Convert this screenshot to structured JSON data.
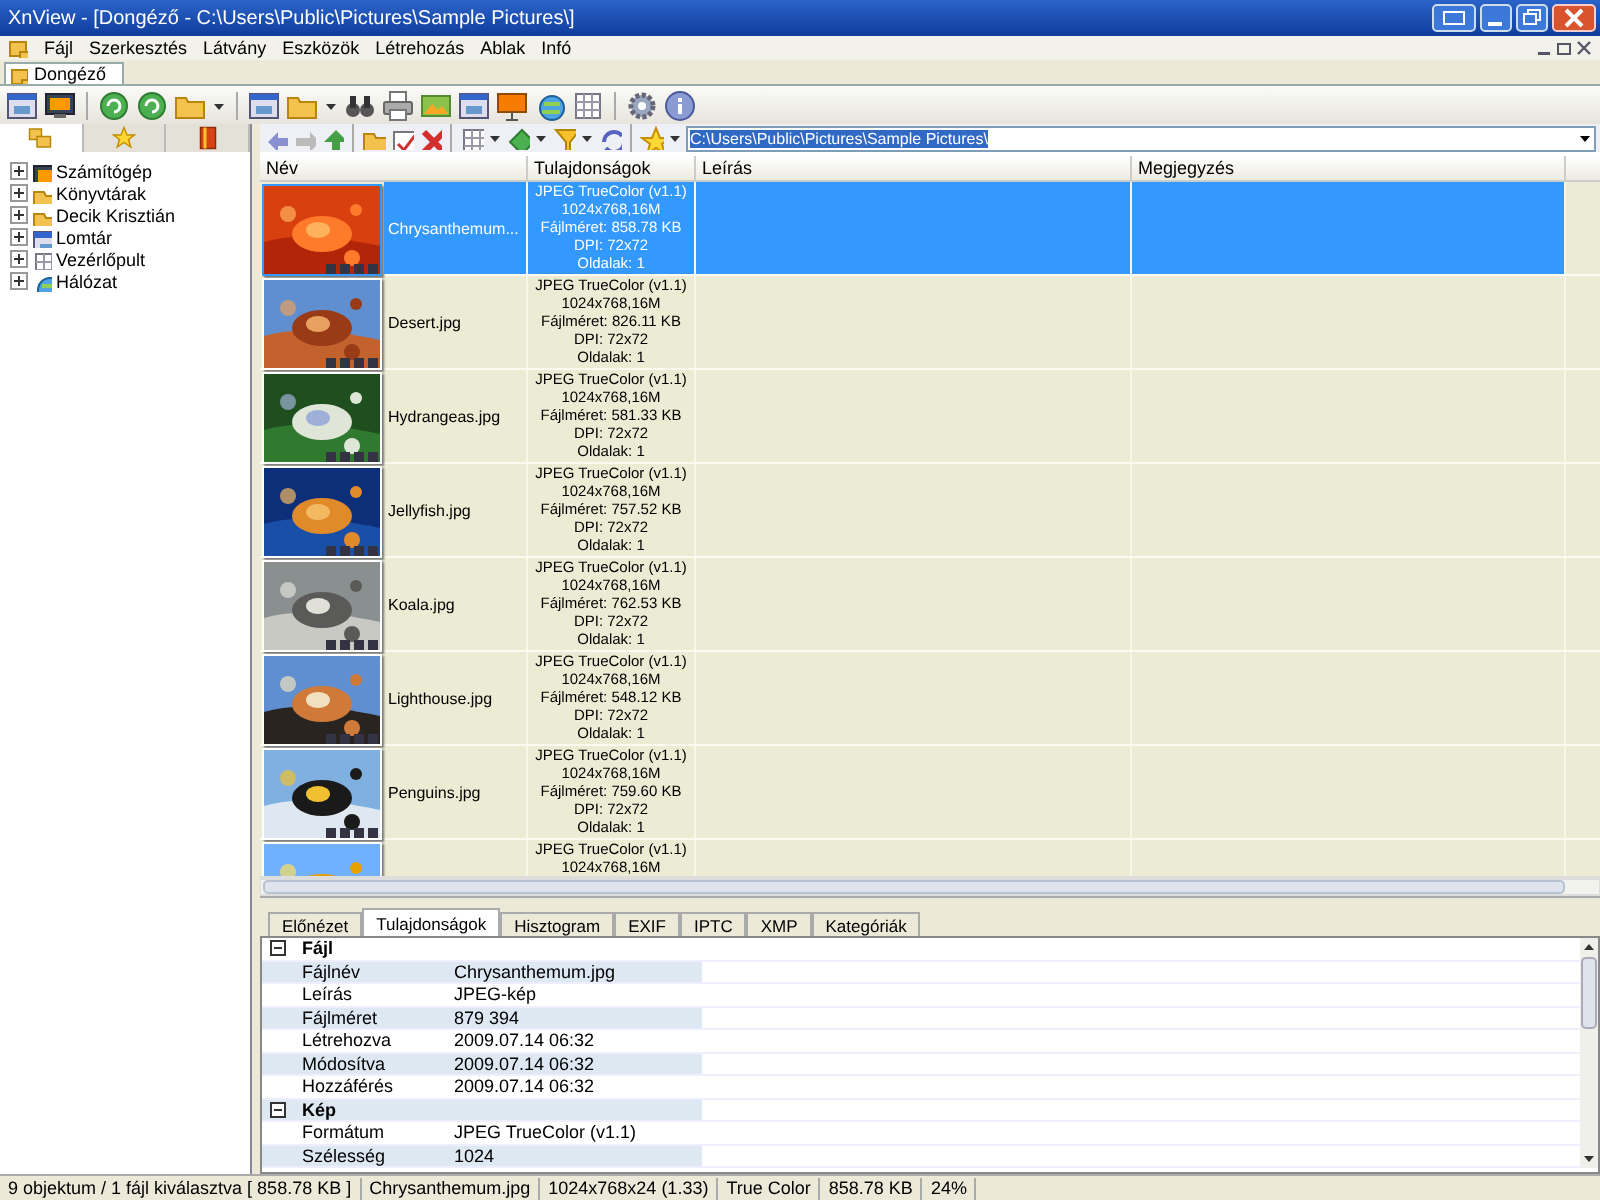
{
  "window": {
    "title": "XnView - [Dongéző - C:\\Users\\Public\\Pictures\\Sample Pictures\\]"
  },
  "menu": [
    "Fájl",
    "Szerkesztés",
    "Látvány",
    "Eszközök",
    "Létrehozás",
    "Ablak",
    "Infó"
  ],
  "document_tabs": [
    {
      "label": "Dongéző",
      "selected": true
    }
  ],
  "left_tabs": [
    {
      "selected": true
    },
    {
      "selected": false
    },
    {
      "selected": false
    }
  ],
  "folder_path": "C:\\Users\\Public\\Pictures\\Sample Pictures\\",
  "tree": [
    "Számítógép",
    "Könyvtárak",
    "Decik Krisztián",
    "Lomtár",
    "Vezérlőpult",
    "Hálózat"
  ],
  "file_list": {
    "columns": [
      "Név",
      "Tulajdonságok",
      "Leírás",
      "Megjegyzés"
    ],
    "rows": [
      {
        "name": "Chrysanthemum...",
        "selected": true,
        "properties": [
          "JPEG TrueColor (v1.1)",
          "1024x768,16M",
          "Fájlméret: 858.78 KB",
          "DPI: 72x72",
          "Oldalak: 1"
        ]
      },
      {
        "name": "Desert.jpg",
        "selected": false,
        "properties": [
          "JPEG TrueColor (v1.1)",
          "1024x768,16M",
          "Fájlméret: 826.11 KB",
          "DPI: 72x72",
          "Oldalak: 1"
        ]
      },
      {
        "name": "Hydrangeas.jpg",
        "selected": false,
        "properties": [
          "JPEG TrueColor (v1.1)",
          "1024x768,16M",
          "Fájlméret: 581.33 KB",
          "DPI: 72x72",
          "Oldalak: 1"
        ]
      },
      {
        "name": "Jellyfish.jpg",
        "selected": false,
        "properties": [
          "JPEG TrueColor (v1.1)",
          "1024x768,16M",
          "Fájlméret: 757.52 KB",
          "DPI: 72x72",
          "Oldalak: 1"
        ]
      },
      {
        "name": "Koala.jpg",
        "selected": false,
        "properties": [
          "JPEG TrueColor (v1.1)",
          "1024x768,16M",
          "Fájlméret: 762.53 KB",
          "DPI: 72x72",
          "Oldalak: 1"
        ]
      },
      {
        "name": "Lighthouse.jpg",
        "selected": false,
        "properties": [
          "JPEG TrueColor (v1.1)",
          "1024x768,16M",
          "Fájlméret: 548.12 KB",
          "DPI: 72x72",
          "Oldalak: 1"
        ]
      },
      {
        "name": "Penguins.jpg",
        "selected": false,
        "properties": [
          "JPEG TrueColor (v1.1)",
          "1024x768,16M",
          "Fájlméret: 759.60 KB",
          "DPI: 72x72",
          "Oldalak: 1"
        ]
      },
      {
        "selected": false,
        "properties": [
          "JPEG TrueColor (v1.1)",
          "1024x768,16M"
        ]
      }
    ]
  },
  "info_tabs": [
    {
      "label": "Előnézet",
      "selected": false
    },
    {
      "label": "Tulajdonságok",
      "selected": true
    },
    {
      "label": "Hisztogram",
      "selected": false
    },
    {
      "label": "EXIF",
      "selected": false
    },
    {
      "label": "IPTC",
      "selected": false
    },
    {
      "label": "XMP",
      "selected": false
    },
    {
      "label": "Kategóriák",
      "selected": false
    }
  ],
  "properties": [
    {
      "kind": "group",
      "label": "Fájl"
    },
    {
      "kind": "field",
      "label": "Fájlnév",
      "value": "Chrysanthemum.jpg"
    },
    {
      "kind": "field",
      "label": "Leírás",
      "value": "JPEG-kép"
    },
    {
      "kind": "field",
      "label": "Fájlméret",
      "value": "879 394"
    },
    {
      "kind": "field",
      "label": "Létrehozva",
      "value": "2009.07.14 06:32"
    },
    {
      "kind": "field",
      "label": "Módosítva",
      "value": "2009.07.14 06:32"
    },
    {
      "kind": "field",
      "label": "Hozzáférés",
      "value": "2009.07.14 06:32"
    },
    {
      "kind": "group",
      "label": "Kép"
    },
    {
      "kind": "field",
      "label": "Formátum",
      "value": "JPEG TrueColor (v1.1)"
    },
    {
      "kind": "field",
      "label": "Szélesség",
      "value": "1024"
    }
  ],
  "status_bar": [
    "9 objektum / 1 fájl kiválasztva [ 858.78 KB ]",
    "Chrysanthemum.jpg",
    "1024x768x24 (1.33)",
    "True Color",
    "858.78 KB",
    "24%"
  ]
}
